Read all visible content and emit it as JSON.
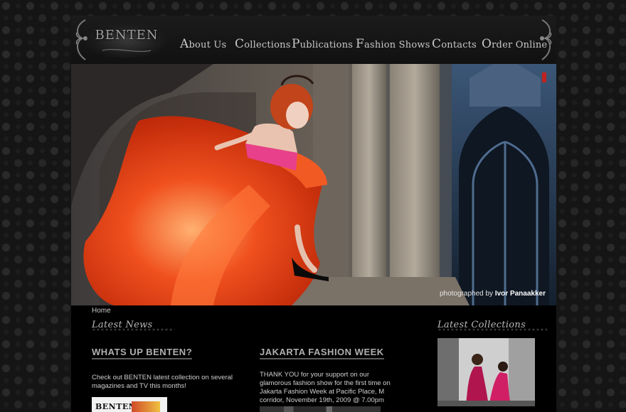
{
  "brand": {
    "logo_text": "BENTEN"
  },
  "nav": {
    "items": [
      {
        "label": "About Us"
      },
      {
        "label": "Collections"
      },
      {
        "label": "Publications"
      },
      {
        "label": "Fashion Shows"
      },
      {
        "label": "Contacts"
      },
      {
        "label": "Order Online"
      }
    ]
  },
  "hero": {
    "credit_prefix": "photographed by",
    "credit_name": "Ivor Panaakker"
  },
  "breadcrumb": "Home",
  "sections": {
    "latest_news": "Latest News",
    "latest_collections": "Latest Collections"
  },
  "news": [
    {
      "title": "WHATS UP BENTEN?",
      "body": "Check out BENTEN latest collection on several magazines and TV this months!",
      "thumb_text": "BENTEN"
    },
    {
      "title": "JAKARTA FASHION WEEK",
      "body": "THANK YOU for your support on our glamorous fashion show for the first time on Jakarta Fashion Week at Pacific Place, M corridor, November 19th, 2009 @ 7.00pm"
    }
  ],
  "colors": {
    "background": "#151515",
    "panel": "#000000",
    "dress": "#f0501e",
    "nav_text": "#c8c8c8"
  }
}
